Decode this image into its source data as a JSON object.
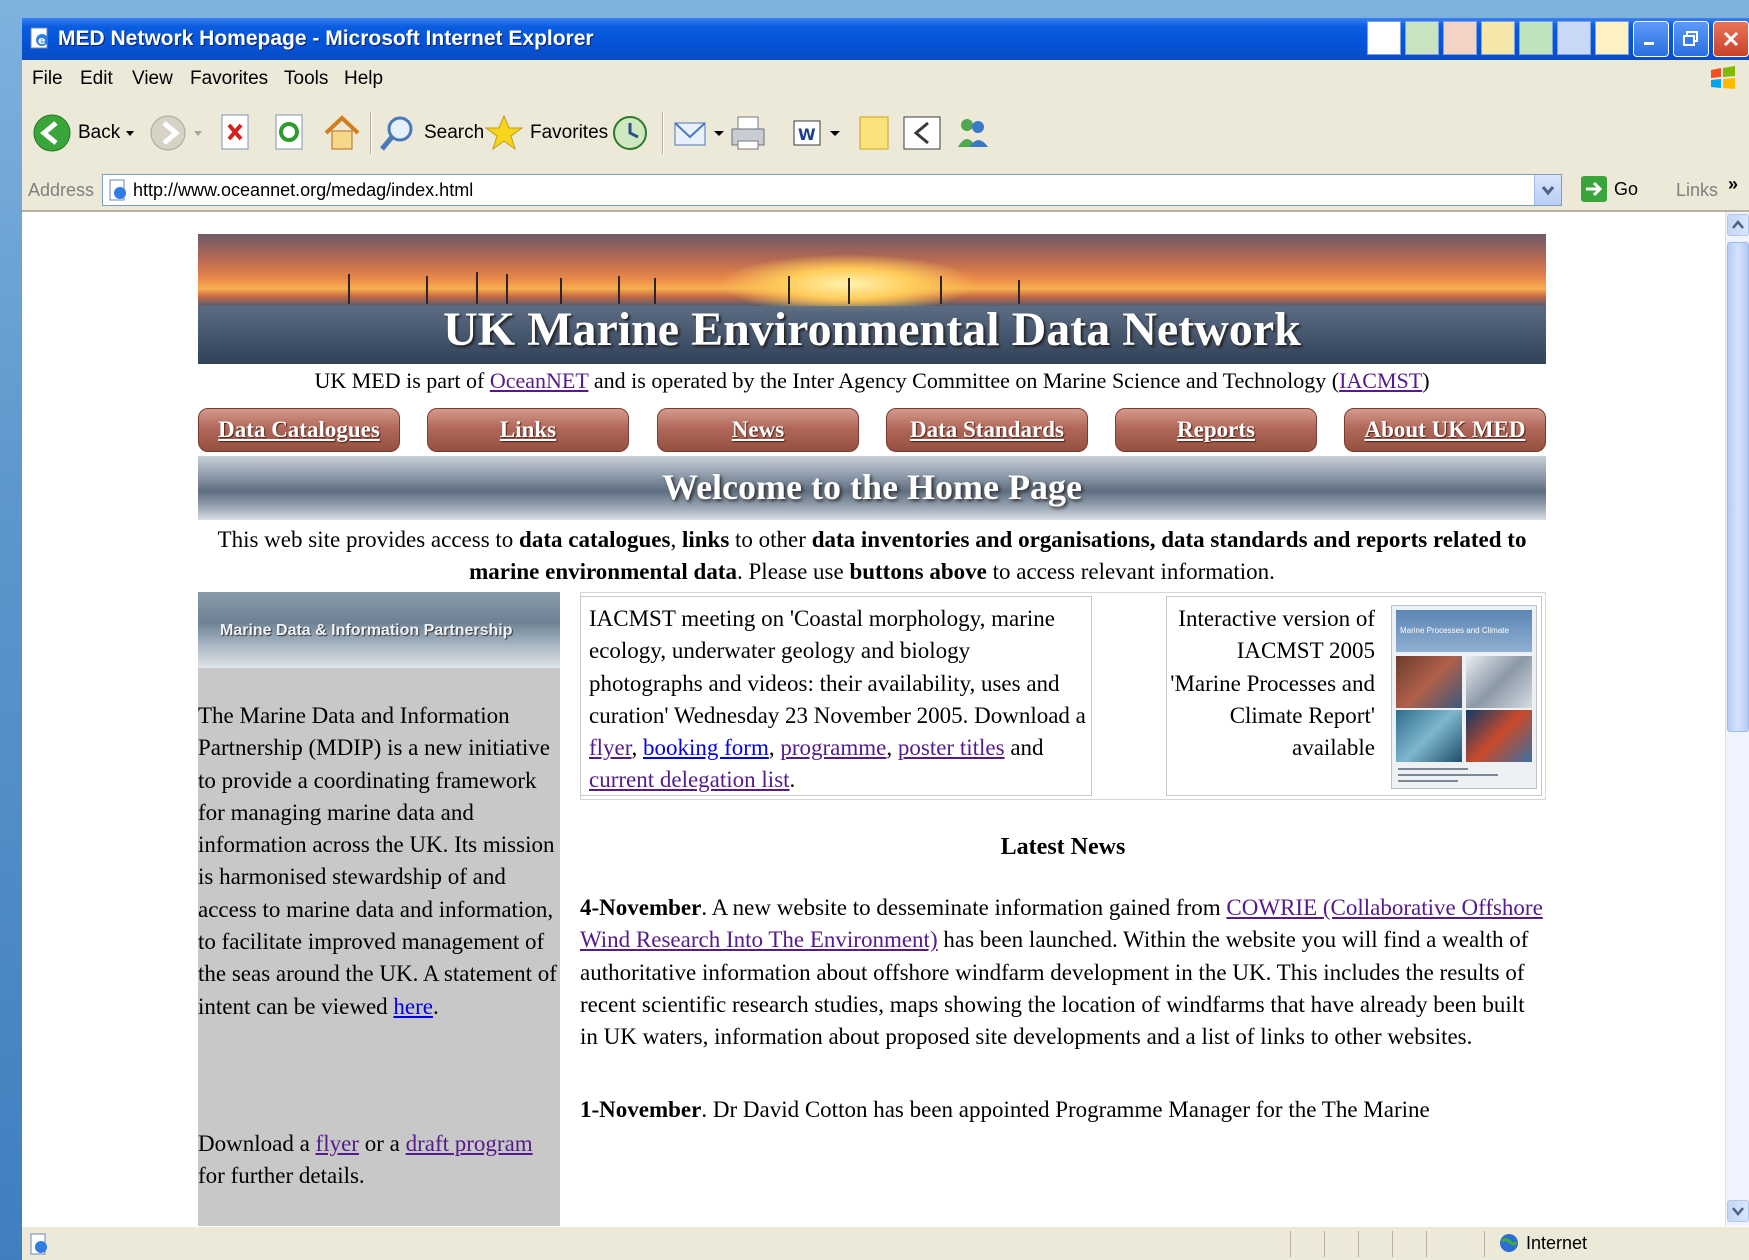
{
  "window": {
    "title": "MED Network Homepage - Microsoft Internet Explorer"
  },
  "menu": [
    "File",
    "Edit",
    "View",
    "Favorites",
    "Tools",
    "Help"
  ],
  "toolbar": {
    "back": "Back",
    "search": "Search",
    "favorites": "Favorites"
  },
  "address": {
    "label": "Address",
    "url": "http://www.oceannet.org/medag/index.html",
    "go": "Go",
    "links": "Links",
    "chevron": "»"
  },
  "status": {
    "zone": "Internet"
  },
  "page": {
    "banner_title": "UK Marine Environmental Data Network",
    "med_line": {
      "t1": "UK MED is part of ",
      "oceannet": "OceanNET",
      "t2": " and is operated by the Inter Agency Committee on Marine Science and Technology (",
      "iacmst": "IACMST",
      "t3": ")"
    },
    "nav": [
      "Data Catalogues",
      "Links",
      "News",
      "Data Standards",
      "Reports",
      "About UK MED"
    ],
    "welcome": "Welcome to the Home Page",
    "intro": {
      "a": "This web site provides access to ",
      "b": "data catalogues",
      "c": ", ",
      "d": "links",
      "e": " to other ",
      "f": "data inventories and organisations, data standards and reports related to marine environmental data",
      "g": ". Please use ",
      "h": "buttons above",
      "i": " to access relevant information."
    },
    "mdip": {
      "banner": "Marine Data & Information Partnership",
      "text": "The Marine Data and Information Partnership (MDIP) is a new initiative to provide a coordinating framework for managing marine data and information across the UK. Its mission is harmonised stewardship of and access to marine data and information, to facilitate improved management of the seas around the UK. A statement of intent can be viewed ",
      "here": "here",
      "period": ".",
      "dl_a": "Download a ",
      "flyer": "flyer",
      "dl_b": " or a ",
      "draft": "draft program",
      "dl_c": " for further details."
    },
    "meeting": {
      "text": "IACMST meeting on 'Coastal morphology, marine ecology, underwater geology and biology photographs and videos: their availability, uses and curation' Wednesday 23 November 2005. Download a ",
      "flyer": "flyer",
      "sep1": ", ",
      "booking": "booking form",
      "sep2": ", ",
      "programme": "programme",
      "sep3": ", ",
      "poster": "poster titles",
      "and": " and ",
      "delegation": "current delegation list",
      "end": "."
    },
    "report": {
      "text": "Interactive version of IACMST 2005 'Marine Processes and Climate Report' available",
      "cover_title": "Marine Processes and Climate"
    },
    "news_heading": "Latest News",
    "news": [
      {
        "date": "4-November",
        "a": ". A new website to desseminate information gained from ",
        "link": "COWRIE (Collaborative Offshore Wind Research Into The Environment)",
        "b": " has been launched. Within the website you will find a wealth of authoritative information about offshore windfarm development in the UK. This includes the results of recent scientific research studies, maps showing the location of windfarms that have already been built in UK waters, information about proposed site developments and a list of links to other websites."
      },
      {
        "date": "1-November",
        "a": ". Dr David Cotton has been appointed Programme Manager for the The Marine"
      }
    ]
  }
}
